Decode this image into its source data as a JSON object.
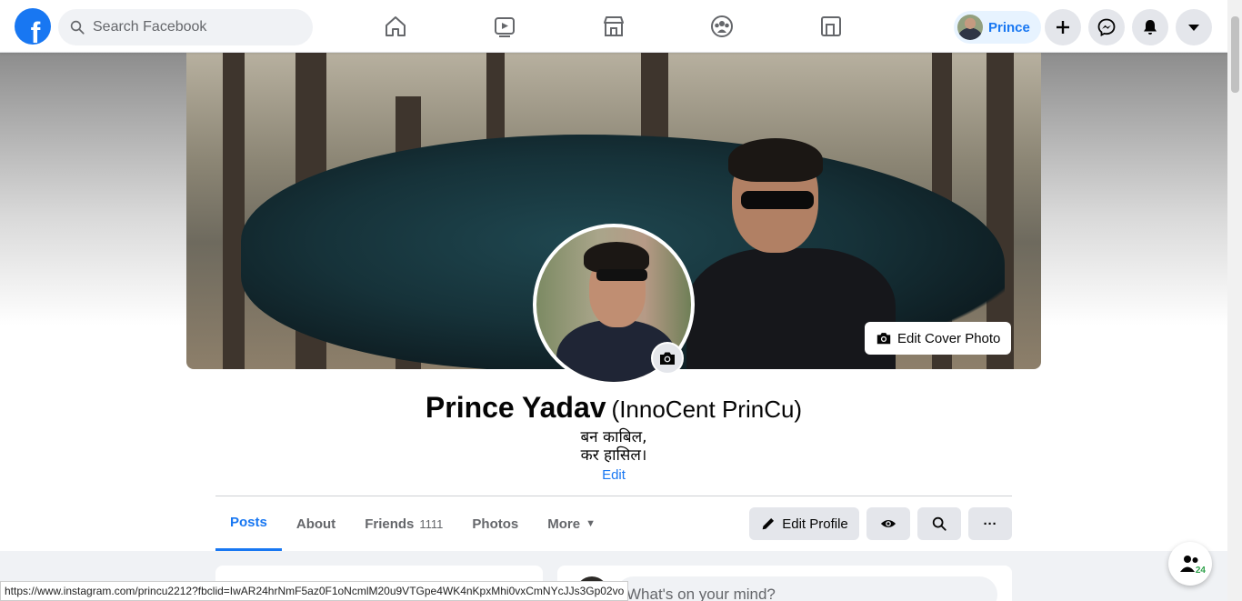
{
  "colors": {
    "brand": "#1877f2",
    "active_tab": "#1877f2",
    "online_badge": "#31a24c"
  },
  "topbar": {
    "logo_letter": "f",
    "search_placeholder": "Search Facebook",
    "nav_icons": [
      "home-icon",
      "watch-icon",
      "marketplace-icon",
      "groups-icon",
      "gaming-icon"
    ],
    "user_name": "Prince",
    "actions": [
      "create-icon",
      "messenger-icon",
      "notifications-icon",
      "account-menu-icon"
    ]
  },
  "cover": {
    "edit_label": "Edit Cover Photo"
  },
  "profile": {
    "name": "Prince Yadav",
    "alternate_name": "(InnoCent PrinCu)",
    "bio_line_1": "बन काबिल,",
    "bio_line_2": "कर हासिल।",
    "bio_edit": "Edit"
  },
  "tabs": [
    {
      "label": "Posts",
      "active": true
    },
    {
      "label": "About"
    },
    {
      "label": "Friends",
      "count": "1111"
    },
    {
      "label": "Photos"
    },
    {
      "label": "More",
      "caret": "▼"
    }
  ],
  "actions": {
    "edit_profile": "Edit Profile",
    "more_glyph": "···"
  },
  "composer": {
    "placeholder": "What's on your mind?"
  },
  "status_url": "https://www.instagram.com/princu2212?fbclid=IwAR24hrNmF5az0F1oNcmlM20u9VTGpe4WK4nKpxMhi0vxCmNYcJJs3Gp02vo",
  "contacts_badge": "24"
}
